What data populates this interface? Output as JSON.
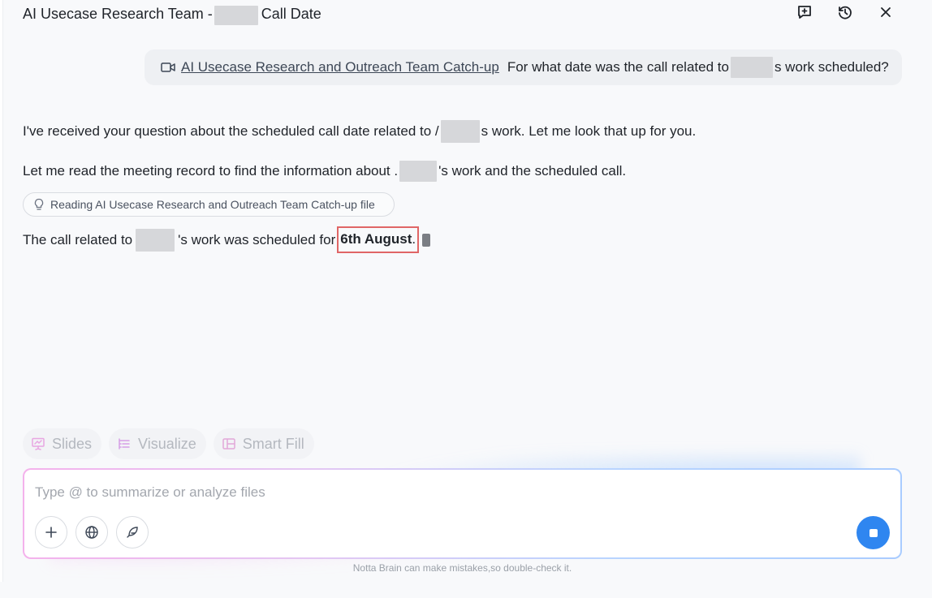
{
  "header": {
    "title_prefix": "AI Usecase Research Team -",
    "title_suffix": "Call Date",
    "icons": [
      "add-chat-icon",
      "history-icon",
      "close-icon"
    ]
  },
  "user_message": {
    "attachment_label": "AI Usecase Research and Outreach Team Catch-up",
    "question_prefix": "For what date was the call related to",
    "question_suffix": "s work scheduled?"
  },
  "assistant": {
    "line1_prefix": "I've received your question about the scheduled call date related to",
    "line1_fragment": "/",
    "line1_suffix": "s work. Let me look that up for you.",
    "line2_prefix": "Let me read the meeting record to find the information about",
    "line2_fragment": ".",
    "line2_suffix": "'s work and the scheduled call.",
    "reading_status": "Reading AI Usecase Research and Outreach Team Catch-up file",
    "answer_prefix": "The call related to",
    "answer_middle": "'s work was scheduled for",
    "answer_date": "6th August",
    "answer_end": "."
  },
  "quick_actions": [
    {
      "label": "Slides",
      "icon": "slides-icon"
    },
    {
      "label": "Visualize",
      "icon": "visualize-icon"
    },
    {
      "label": "Smart Fill",
      "icon": "smart-fill-icon"
    }
  ],
  "composer": {
    "placeholder": "Type @ to summarize or analyze files",
    "buttons": [
      "plus-icon",
      "globe-icon",
      "feather-icon"
    ],
    "stop_color": "#2f86f0"
  },
  "disclaimer": "Notta Brain can make mistakes,so double-check it."
}
